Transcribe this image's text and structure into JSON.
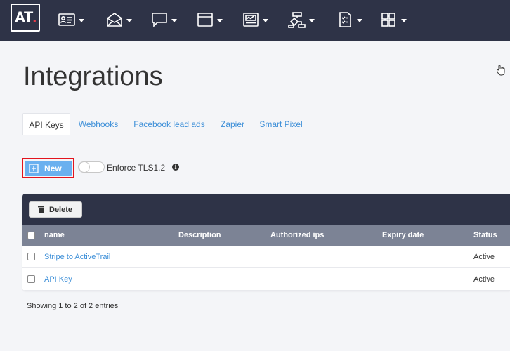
{
  "app": {
    "logo_text": "AT",
    "logo_dot": "."
  },
  "nav": [
    {
      "icon": "contacts-icon"
    },
    {
      "icon": "email-icon"
    },
    {
      "icon": "sms-icon"
    },
    {
      "icon": "landing-page-icon"
    },
    {
      "icon": "reports-icon"
    },
    {
      "icon": "automation-icon"
    },
    {
      "icon": "forms-icon"
    },
    {
      "icon": "integrations-icon"
    }
  ],
  "page": {
    "title": "Integrations"
  },
  "tabs": [
    {
      "label": "API Keys",
      "active": true
    },
    {
      "label": "Webhooks"
    },
    {
      "label": "Facebook lead ads"
    },
    {
      "label": "Zapier"
    },
    {
      "label": "Smart Pixel"
    }
  ],
  "toolbar": {
    "new_label": "New",
    "toggle_label": "Enforce TLS1.2",
    "info_symbol": "i"
  },
  "table": {
    "delete_label": "Delete",
    "columns": [
      "name",
      "Description",
      "Authorized ips",
      "Expiry date",
      "Status"
    ],
    "rows": [
      {
        "name": "Stripe to ActiveTrail",
        "description": "",
        "ips": "",
        "expiry": "",
        "status": "Active"
      },
      {
        "name": "API Key",
        "description": "",
        "ips": "",
        "expiry": "",
        "status": "Active"
      }
    ]
  },
  "footer": {
    "info": "Showing 1 to 2 of 2 entries"
  },
  "colors": {
    "topbar": "#2e3347",
    "accent_link": "#3d8fd8",
    "new_button": "#6ab0ef",
    "highlight": "#e3141e",
    "table_header": "#7c8395"
  }
}
